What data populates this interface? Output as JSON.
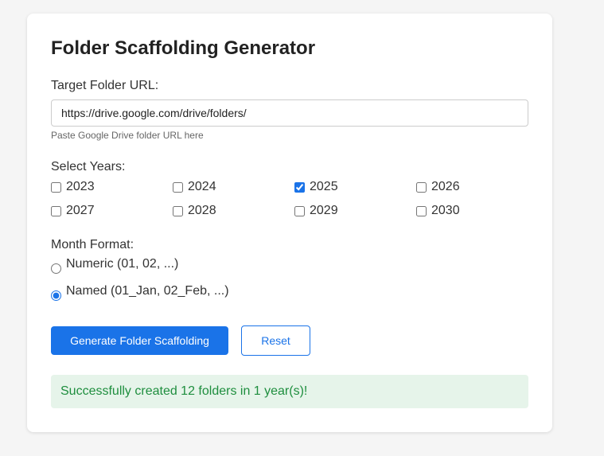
{
  "title": "Folder Scaffolding Generator",
  "url_field": {
    "label": "Target Folder URL:",
    "value": "https://drive.google.com/drive/folders/",
    "hint": "Paste Google Drive folder URL here"
  },
  "years": {
    "label": "Select Years:",
    "items": [
      {
        "label": "2023",
        "checked": false
      },
      {
        "label": "2024",
        "checked": false
      },
      {
        "label": "2025",
        "checked": true
      },
      {
        "label": "2026",
        "checked": false
      },
      {
        "label": "2027",
        "checked": false
      },
      {
        "label": "2028",
        "checked": false
      },
      {
        "label": "2029",
        "checked": false
      },
      {
        "label": "2030",
        "checked": false
      }
    ]
  },
  "month_format": {
    "label": "Month Format:",
    "options": [
      {
        "label": "Numeric (01, 02, ...)",
        "checked": false
      },
      {
        "label": "Named (01_Jan, 02_Feb, ...)",
        "checked": true
      }
    ]
  },
  "buttons": {
    "generate_label": "Generate Folder Scaffolding",
    "reset_label": "Reset"
  },
  "status": {
    "message": "Successfully created 12 folders in 1 year(s)!"
  },
  "colors": {
    "accent": "#1a73e8",
    "success_bg": "#e6f4ea",
    "success_text": "#1e8e3e"
  }
}
